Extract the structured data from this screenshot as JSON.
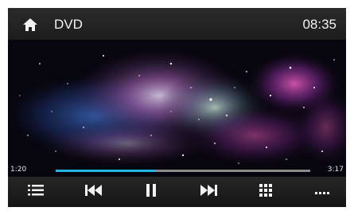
{
  "header": {
    "title": "DVD",
    "clock": "08:35",
    "home_icon": "home-icon"
  },
  "playback": {
    "elapsed": "1:20",
    "total": "3:17",
    "progress_fraction": 0.39
  },
  "controls": [
    {
      "name": "playlist-icon"
    },
    {
      "name": "skip-previous-icon"
    },
    {
      "name": "pause-icon"
    },
    {
      "name": "skip-next-icon"
    },
    {
      "name": "grid-menu-icon"
    },
    {
      "name": "more-options-icon"
    }
  ],
  "colors": {
    "accent": "#21b6e0",
    "track": "#8a8a8a",
    "bar": "#1f1f1f",
    "text": "#f2f2f2"
  }
}
